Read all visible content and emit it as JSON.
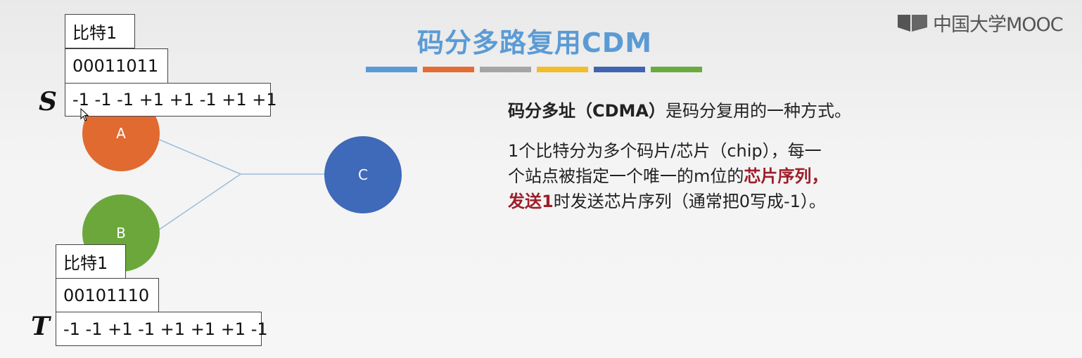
{
  "logo": {
    "text": "中国大学MOOC",
    "icon": "mooc-logo-icon"
  },
  "title": {
    "text": "码分多路复用CDM"
  },
  "title_bar_colors": [
    "#5b9bd5",
    "#e46c32",
    "#a5a5a5",
    "#f3bc2d",
    "#3f65b1",
    "#6aab3f"
  ],
  "nodes": {
    "A": {
      "label": "A",
      "color": "#e06a2f"
    },
    "B": {
      "label": "B",
      "color": "#6ca73c"
    },
    "C": {
      "label": "C",
      "color": "#3f69b9"
    }
  },
  "station_S": {
    "label": "S",
    "bit_label": "比特1",
    "code": "00011011",
    "chip_sequence": "-1 -1 -1 +1 +1 -1 +1 +1"
  },
  "station_T": {
    "label": "T",
    "bit_label": "比特1",
    "code": "00101110",
    "chip_sequence": "-1 -1 +1 -1 +1 +1 +1 -1"
  },
  "description": {
    "line1_bold": "码分多址（CDMA）",
    "line1_rest": "是码分复用的一种方式。",
    "para2_line1": "1个比特分为多个码片/芯片（chip），每一",
    "para2_line2_plain": "个站点被指定一个唯一的m位的",
    "para2_line2_highlight": "芯片序列，",
    "para2_line3_highlight": "发送1",
    "para2_line3_plain": "时发送芯片序列（通常把0写成-1）。"
  }
}
